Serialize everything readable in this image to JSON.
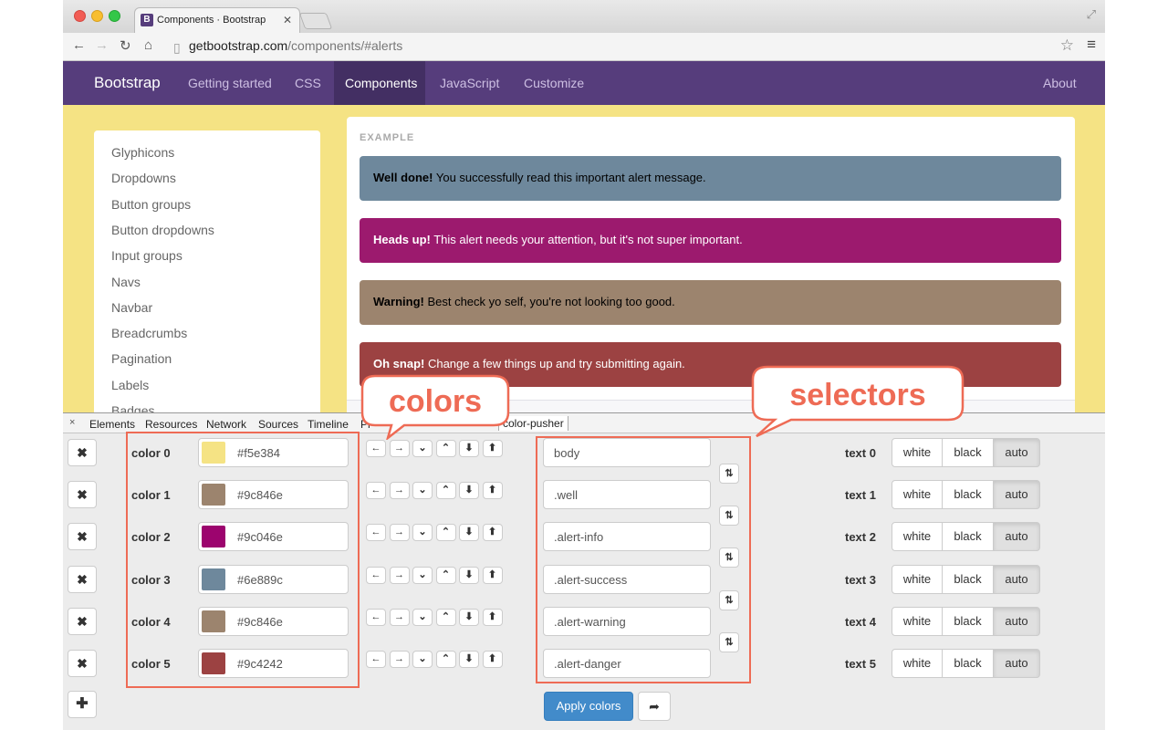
{
  "browser": {
    "tab_title": "Components · Bootstrap",
    "tab_favicon": "B",
    "tab_close": "✕",
    "url_host": "getbootstrap.com",
    "url_path": "/components/#alerts"
  },
  "navbar": {
    "brand": "Bootstrap",
    "links": [
      "Getting started",
      "CSS",
      "Components",
      "JavaScript",
      "Customize"
    ],
    "active": "Components",
    "right_link": "About"
  },
  "sidenav": [
    "Glyphicons",
    "Dropdowns",
    "Button groups",
    "Button dropdowns",
    "Input groups",
    "Navs",
    "Navbar",
    "Breadcrumbs",
    "Pagination",
    "Labels",
    "Badges"
  ],
  "example": {
    "label": "EXAMPLE",
    "alerts": [
      {
        "strong": "Well done!",
        "text": " You successfully read this important alert message.",
        "bg": "#6e889c",
        "fg": "#000000"
      },
      {
        "strong": "Heads up!",
        "text": " This alert needs your attention, but it's not super important.",
        "bg": "#9c1a6e",
        "fg": "#ffffff"
      },
      {
        "strong": "Warning!",
        "text": " Best check yo self, you're not looking too good.",
        "bg": "#9c846e",
        "fg": "#000000"
      },
      {
        "strong": "Oh snap!",
        "text": " Change a few things up and try submitting again.",
        "bg": "#9c4242",
        "fg": "#ffffff"
      }
    ]
  },
  "devtools": {
    "close": "×",
    "tabs": [
      "Elements",
      "Resources",
      "Network",
      "Sources",
      "Timeline",
      "Pr",
      "color-pusher"
    ],
    "active_tab": "color-pusher"
  },
  "pusher": {
    "colors": [
      {
        "label": "color 0",
        "hex": "#f5e384"
      },
      {
        "label": "color 1",
        "hex": "#9c846e"
      },
      {
        "label": "color 2",
        "hex": "#9c046e"
      },
      {
        "label": "color 3",
        "hex": "#6e889c"
      },
      {
        "label": "color 4",
        "hex": "#9c846e"
      },
      {
        "label": "color 5",
        "hex": "#9c4242"
      }
    ],
    "selectors": [
      "body",
      ".well",
      ".alert-info",
      ".alert-success",
      ".alert-warning",
      ".alert-danger"
    ],
    "texts": [
      "text 0",
      "text 1",
      "text 2",
      "text 3",
      "text 4",
      "text 5"
    ],
    "text_options": {
      "white": "white",
      "black": "black",
      "auto": "auto"
    },
    "text_selected": "auto",
    "apply_label": "Apply colors",
    "remove_symbol": "✖",
    "add_symbol": "✚",
    "arrow_buttons": [
      "left-arrow-icon",
      "right-arrow-icon",
      "chevron-down-icon",
      "chevron-up-icon",
      "circle-down-icon",
      "circle-up-icon"
    ]
  },
  "annotations": {
    "colors": "colors",
    "selectors": "selectors",
    "color": "#ee6b55"
  }
}
